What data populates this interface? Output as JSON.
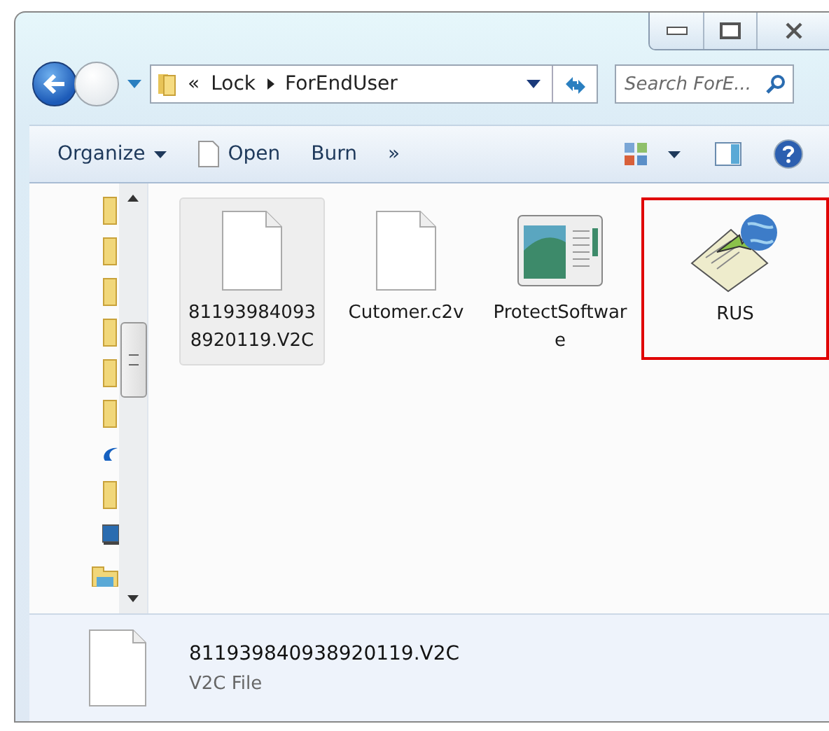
{
  "address_bar": {
    "segments": [
      "«",
      "Lock",
      "ForEndUser"
    ]
  },
  "search": {
    "placeholder": "Search ForE..."
  },
  "toolbar": {
    "items": [
      {
        "label": "Organize",
        "kind": "menu"
      },
      {
        "label": "Open",
        "kind": "file"
      },
      {
        "label": "Burn",
        "kind": "plain"
      },
      {
        "label": "»",
        "kind": "plain"
      }
    ]
  },
  "navigation_pane": {
    "items": [
      {
        "kind": "folder"
      },
      {
        "kind": "folder"
      },
      {
        "kind": "folder"
      },
      {
        "kind": "folder"
      },
      {
        "kind": "folder"
      },
      {
        "kind": "folder"
      },
      {
        "kind": "cloud"
      },
      {
        "kind": "folder"
      },
      {
        "kind": "computer"
      },
      {
        "kind": "library"
      }
    ]
  },
  "files": [
    {
      "name": "811939840938920119.V2C",
      "kind": "document",
      "selected": true,
      "highlighted": false
    },
    {
      "name": "Cutomer.c2v",
      "kind": "document",
      "selected": false,
      "highlighted": false
    },
    {
      "name": "ProtectSoftware",
      "kind": "program",
      "selected": false,
      "highlighted": false
    },
    {
      "name": "RUS",
      "kind": "installer",
      "selected": false,
      "highlighted": true
    }
  ],
  "details_pane": {
    "name": "811939840938920119.V2C",
    "type": "V2C File"
  }
}
